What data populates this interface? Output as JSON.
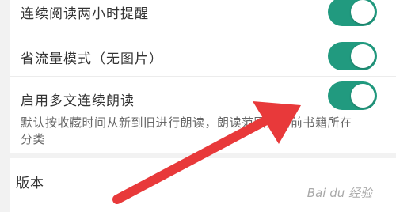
{
  "settings": {
    "items": [
      {
        "label": "连续阅读两小时提醒",
        "enabled": true
      },
      {
        "label": "省流量模式（无图片）",
        "enabled": true
      },
      {
        "label": "启用多文连续朗读",
        "enabled": true,
        "description": "默认按收藏时间从新到旧进行朗读，朗读范围为当前书籍所在分类"
      }
    ]
  },
  "version": {
    "title": "版本"
  },
  "annotation": {
    "arrow_color": "#e8393a"
  },
  "watermark": {
    "text": "Bai du 经验"
  },
  "colors": {
    "toggle_on": "#219a7f",
    "background": "#f2f2f2"
  }
}
